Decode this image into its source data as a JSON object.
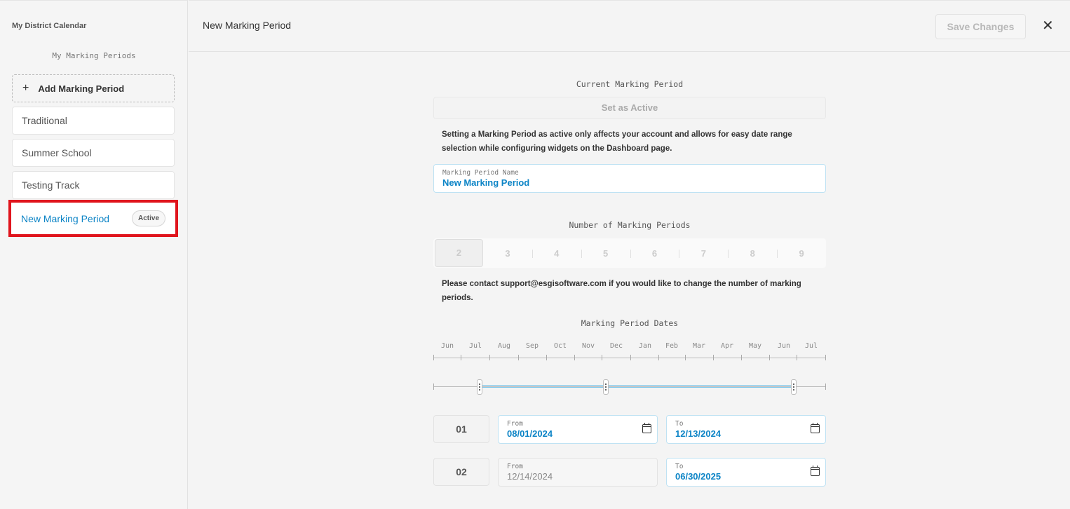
{
  "sidebar": {
    "district_title": "My District Calendar",
    "section_title": "My Marking Periods",
    "add_label": "Add Marking Period",
    "add_icon": "plus-icon",
    "items": [
      {
        "label": "Traditional"
      },
      {
        "label": "Summer School"
      },
      {
        "label": "Testing Track"
      },
      {
        "label": "New Marking Period",
        "badge": "Active",
        "selected": true
      }
    ]
  },
  "header": {
    "title": "New Marking Period",
    "save_label": "Save Changes",
    "close_icon": "close-icon"
  },
  "form": {
    "current_label": "Current Marking Period",
    "set_active_label": "Set as Active",
    "active_note": "Setting a Marking Period as active only affects your account and allows for easy date range selection while configuring widgets on the Dashboard page.",
    "name_label": "Marking Period Name",
    "name_value": "New Marking Period",
    "count_label": "Number of Marking Periods",
    "count_options": [
      "2",
      "3",
      "4",
      "5",
      "6",
      "7",
      "8",
      "9"
    ],
    "count_selected": "2",
    "count_note": "Please contact support@esgisoftware.com if you would like to change the number of marking periods.",
    "dates_label": "Marking Period Dates",
    "months": [
      "Jun",
      "Jul",
      "Aug",
      "Sep",
      "Oct",
      "Nov",
      "Dec",
      "Jan",
      "Feb",
      "Mar",
      "Apr",
      "May",
      "Jun",
      "Jul"
    ],
    "periods": [
      {
        "number": "01",
        "from_label": "From",
        "from": "08/01/2024",
        "to_label": "To",
        "to": "12/13/2024"
      },
      {
        "number": "02",
        "from_label": "From",
        "from": "12/14/2024",
        "to_label": "To",
        "to": "06/30/2025"
      }
    ],
    "accent_color": "#0c84c6",
    "highlight_color": "#e0151d"
  }
}
